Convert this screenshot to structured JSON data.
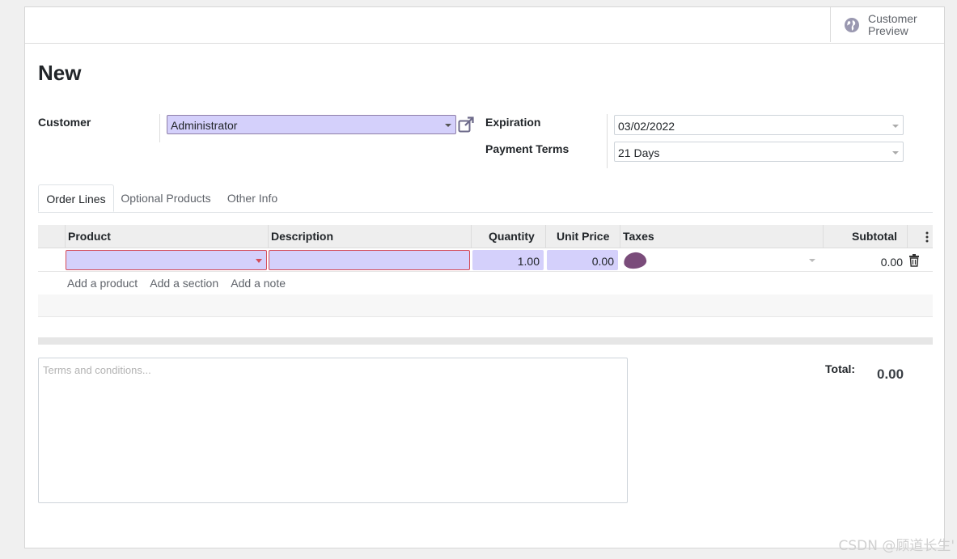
{
  "status_bar": {
    "preview_label": "Customer Preview"
  },
  "form": {
    "title": "New",
    "customer": {
      "label": "Customer",
      "value": "Administrator"
    },
    "expiration": {
      "label": "Expiration",
      "value": "03/02/2022"
    },
    "payment_terms": {
      "label": "Payment Terms",
      "value": "21 Days"
    }
  },
  "tabs": [
    {
      "label": "Order Lines",
      "active": true
    },
    {
      "label": "Optional Products",
      "active": false
    },
    {
      "label": "Other Info",
      "active": false
    }
  ],
  "order_lines": {
    "columns": [
      "Product",
      "Description",
      "Quantity",
      "Unit Price",
      "Taxes",
      "Subtotal"
    ],
    "row": {
      "product": "",
      "description": "",
      "quantity": "1.00",
      "unit_price": "0.00",
      "subtotal": "0.00"
    },
    "add_links": [
      "Add a product",
      "Add a section",
      "Add a note"
    ]
  },
  "notes": {
    "placeholder": "Terms and conditions..."
  },
  "totals": {
    "label": "Total:",
    "value": "0.00"
  },
  "watermark": "CSDN @顾道长生'",
  "colors": {
    "input_bg": "#d4d0fb",
    "invalid_border": "#d44c59",
    "header_bg": "#eeeeee",
    "tag": "#7a4c7a"
  }
}
